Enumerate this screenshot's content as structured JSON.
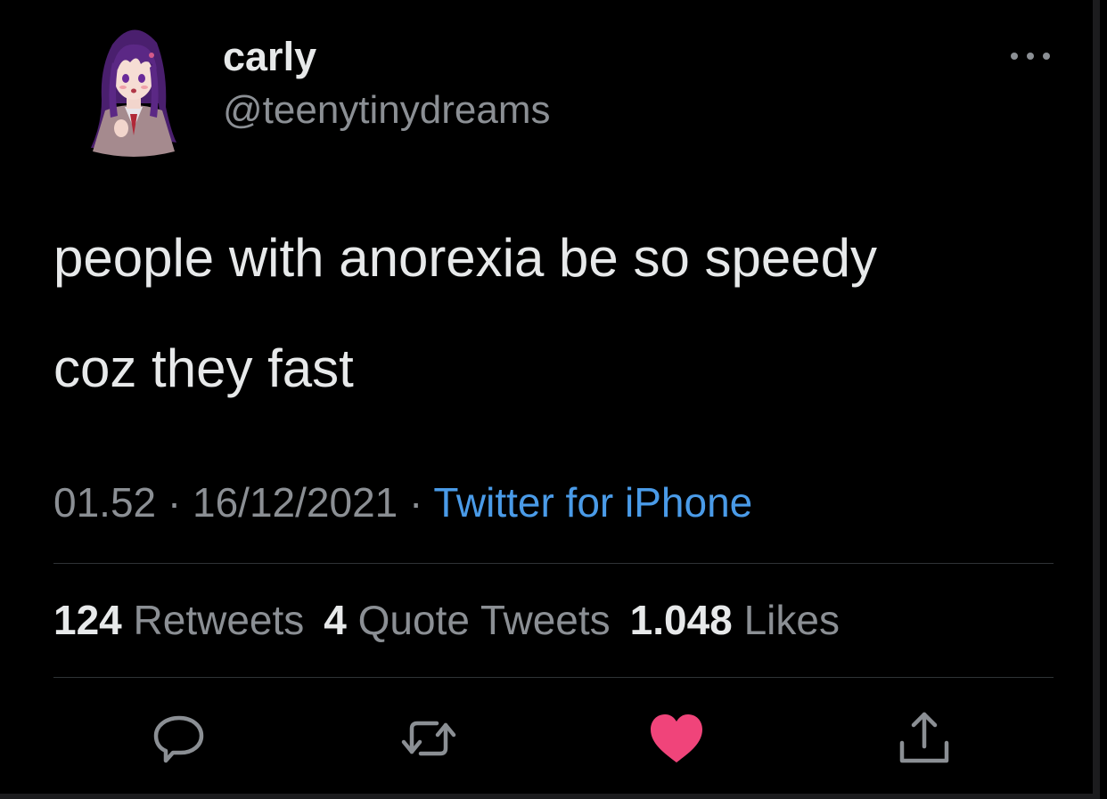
{
  "author": {
    "display_name": "carly",
    "handle": "@teenytinydreams",
    "avatar_icon": "anime-girl-avatar"
  },
  "menu": {
    "more_icon": "more-horizontal-icon"
  },
  "tweet": {
    "lines": [
      "people with anorexia be so speedy",
      "coz they fast"
    ]
  },
  "meta": {
    "time": "01.52",
    "separator": "·",
    "date": "16/12/2021",
    "source": "Twitter for iPhone"
  },
  "stats": {
    "retweets": {
      "count": "124",
      "label": "Retweets"
    },
    "quotes": {
      "count": "4",
      "label": "Quote Tweets"
    },
    "likes": {
      "count": "1.048",
      "label": "Likes"
    }
  },
  "actions": {
    "reply_icon": "reply-icon",
    "retweet_icon": "retweet-icon",
    "like_icon": "heart-icon",
    "share_icon": "share-icon",
    "liked": true
  },
  "colors": {
    "background": "#000000",
    "text_primary": "#e7e9ea",
    "text_secondary": "#8b8f94",
    "link": "#4a9be8",
    "like": "#f0447a",
    "divider": "#2f3336"
  }
}
